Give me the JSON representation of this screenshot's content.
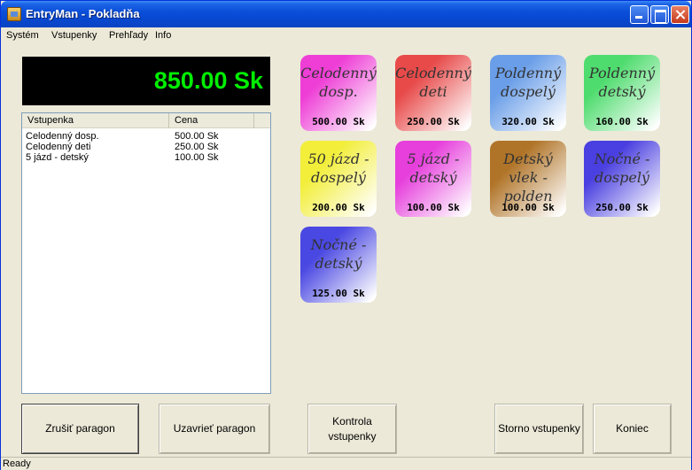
{
  "window": {
    "title": "EntryMan - Pokladňa"
  },
  "menu": {
    "items": [
      "Systém",
      "Vstupenky",
      "Prehľady",
      "Info"
    ]
  },
  "total": "850.00 Sk",
  "list": {
    "columns": [
      "Vstupenka",
      "Cena",
      ""
    ],
    "rows": [
      {
        "ticket": "Celodenný dosp.",
        "price": "500.00 Sk"
      },
      {
        "ticket": "Celodenný deti",
        "price": "250.00 Sk"
      },
      {
        "ticket": "5 jázd - detský",
        "price": "100.00 Sk"
      }
    ]
  },
  "tickets": [
    {
      "name": "Celodenný dosp.",
      "price": "500.00 Sk",
      "color": "#ee3ed6"
    },
    {
      "name": "Celodenný deti",
      "price": "250.00 Sk",
      "color": "#e84a4a"
    },
    {
      "name": "Poldenný dospelý",
      "price": "320.00 Sk",
      "color": "#6a9ee8"
    },
    {
      "name": "Poldenný detský",
      "price": "160.00 Sk",
      "color": "#4fdc6e"
    },
    {
      "name": "50 jázd - dospelý",
      "price": "200.00 Sk",
      "color": "#f2ee3a"
    },
    {
      "name": "5 jázd - detský",
      "price": "100.00 Sk",
      "color": "#e63fdc"
    },
    {
      "name": "Detský vlek - polden",
      "price": "100.00 Sk",
      "color": "#b07428"
    },
    {
      "name": "Nočné - dospelý",
      "price": "250.00 Sk",
      "color": "#4a3fe0"
    },
    {
      "name": "Nočné - detský",
      "price": "125.00 Sk",
      "color": "#4a48e2"
    }
  ],
  "buttons": {
    "cancel": "Zrušiť paragon",
    "close_receipt": "Uzavrieť paragon",
    "check": "Kontrola vstupenky",
    "storno": "Storno vstupenky",
    "exit": "Koniec"
  },
  "status": "Ready"
}
